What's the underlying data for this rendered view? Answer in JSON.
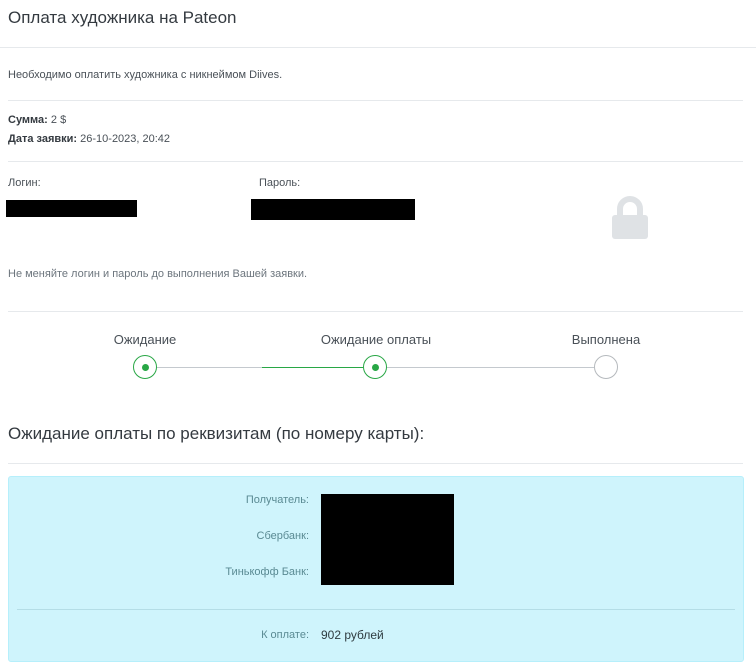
{
  "page": {
    "title": "Оплата художника на Pateon",
    "notice": "Необходимо оплатить художника с никнеймом Diives."
  },
  "order": {
    "sum_label": "Сумма:",
    "sum_value": "2 $",
    "date_label": "Дата заявки:",
    "date_value": "26-10-2023, 20:42"
  },
  "credentials": {
    "login_label": "Логин:",
    "password_label": "Пароль:",
    "lock_icon": "lock-icon",
    "warning": "Не меняйте логин и пароль до выполнения Вашей заявки."
  },
  "stepper": {
    "steps": [
      {
        "label": "Ожидание",
        "state": "done"
      },
      {
        "label": "Ожидание оплаты",
        "state": "current"
      },
      {
        "label": "Выполнена",
        "state": "pending"
      }
    ],
    "active_color": "#28a745",
    "pending_color": "#b5b9bd"
  },
  "payment": {
    "heading": "Ожидание оплаты по реквизитам (по номеру карты):",
    "recipient_label": "Получатель:",
    "sberbank_label": "Сбербанк:",
    "tinkoff_label": "Тинькофф Банк:",
    "amount_label": "К оплате:",
    "amount_value": "902 рублей",
    "panel_color": "#cff4fc"
  }
}
